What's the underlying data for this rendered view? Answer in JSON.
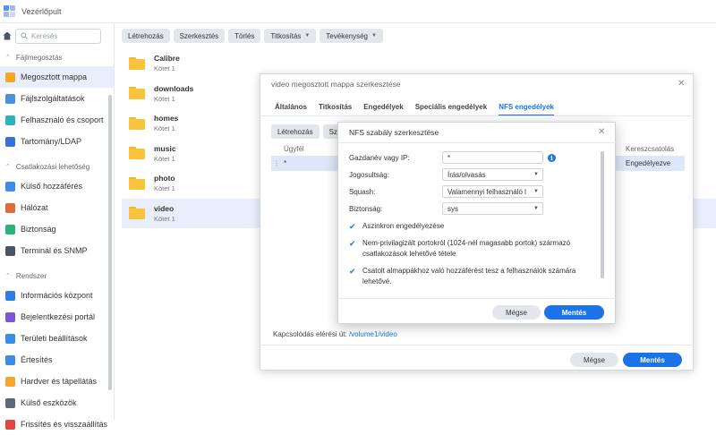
{
  "app": {
    "title": "Vezérlőpult",
    "logo_icon": "control-panel-logo-icon"
  },
  "search": {
    "placeholder": "Keresés"
  },
  "sidebar": {
    "sections": [
      {
        "label": "Fájlmegosztás",
        "items": [
          {
            "label": "Megosztott mappa",
            "icon": "shared-folder-icon",
            "color": "#f5a623",
            "active": true
          },
          {
            "label": "Fájlszolgáltatások",
            "icon": "file-services-icon",
            "color": "#4a90e2"
          },
          {
            "label": "Felhasználó és csoport",
            "icon": "user-group-icon",
            "color": "#2bb3c0"
          },
          {
            "label": "Tartomány/LDAP",
            "icon": "domain-ldap-icon",
            "color": "#3b6fd8"
          }
        ]
      },
      {
        "label": "Csatlakozási lehetőség",
        "items": [
          {
            "label": "Külső hozzáférés",
            "icon": "external-access-icon",
            "color": "#3b8de8"
          },
          {
            "label": "Hálózat",
            "icon": "network-icon",
            "color": "#e06c3c"
          },
          {
            "label": "Biztonság",
            "icon": "security-shield-icon",
            "color": "#27b57a"
          },
          {
            "label": "Terminál és SNMP",
            "icon": "terminal-icon",
            "color": "#4a5563"
          }
        ]
      },
      {
        "label": "Rendszer",
        "items": [
          {
            "label": "Információs központ",
            "icon": "info-center-icon",
            "color": "#2f7de1"
          },
          {
            "label": "Bejelentkezési portál",
            "icon": "login-portal-icon",
            "color": "#7b56d6"
          },
          {
            "label": "Területi beállítások",
            "icon": "regional-options-icon",
            "color": "#3a8ee6"
          },
          {
            "label": "Értesítés",
            "icon": "notification-icon",
            "color": "#3a8ee6"
          },
          {
            "label": "Hardver és tápellátás",
            "icon": "hardware-power-icon",
            "color": "#f3a62b"
          },
          {
            "label": "Külső eszközök",
            "icon": "external-devices-icon",
            "color": "#5a6a7a"
          },
          {
            "label": "Frissítés és visszaállítás",
            "icon": "update-restore-icon",
            "color": "#e2453c"
          }
        ]
      }
    ]
  },
  "toolbar": {
    "create": "Létrehozás",
    "edit": "Szerkesztés",
    "delete": "Törlés",
    "encryption": "Titkosítás",
    "action": "Tevékenység"
  },
  "files": [
    {
      "name": "Calibre",
      "volume": "Kötet 1"
    },
    {
      "name": "downloads",
      "volume": "Kötet 1"
    },
    {
      "name": "homes",
      "volume": "Kötet 1"
    },
    {
      "name": "music",
      "volume": "Kötet 1"
    },
    {
      "name": "photo",
      "volume": "Kötet 1"
    },
    {
      "name": "video",
      "volume": "Kötet 1",
      "selected": true
    }
  ],
  "edit_dialog": {
    "title": "video megosztott mappa szerkesztése",
    "tabs": [
      "Általános",
      "Titkosítás",
      "Engedélyek",
      "Speciális engedélyek",
      "NFS engedélyek"
    ],
    "active_tab": "NFS engedélyek",
    "create": "Létrehozás",
    "edit_partial": "Sz",
    "col_client": "Ügyfél",
    "col_crossmount": "Kereszcsatolás",
    "row_client": "*",
    "row_crossmount": "Engedélyezve",
    "conn_path_label": "Kapcsolódás elérési út:",
    "conn_path": "/volume1/video",
    "cancel": "Mégse",
    "save": "Mentés"
  },
  "nfs_dialog": {
    "title": "NFS szabály szerkesztése",
    "hostname_label": "Gazdanév vagy IP:",
    "hostname_value": "*",
    "privilege_label": "Jogosultság:",
    "privilege_value": "Írás/olvasás",
    "squash_label": "Squash:",
    "squash_value": "Valamennyi felhasználó l",
    "security_label": "Biztonság:",
    "security_value": "sys",
    "async_label": "Aszinkron engedélyezése",
    "nonpriv_label": "Nem-privilagizált portokról (1024-nél magasabb portok) származó csatlakozások lehetővé tétele",
    "subfolder_label": "Csatolt almappákhoz való hozzáférést tesz a felhasználók számára lehetővé.",
    "cancel": "Mégse",
    "save": "Mentés"
  },
  "colors": {
    "accent": "#1a73e8",
    "folder": "#f9c33c",
    "selected_bg": "#e8eefb"
  }
}
